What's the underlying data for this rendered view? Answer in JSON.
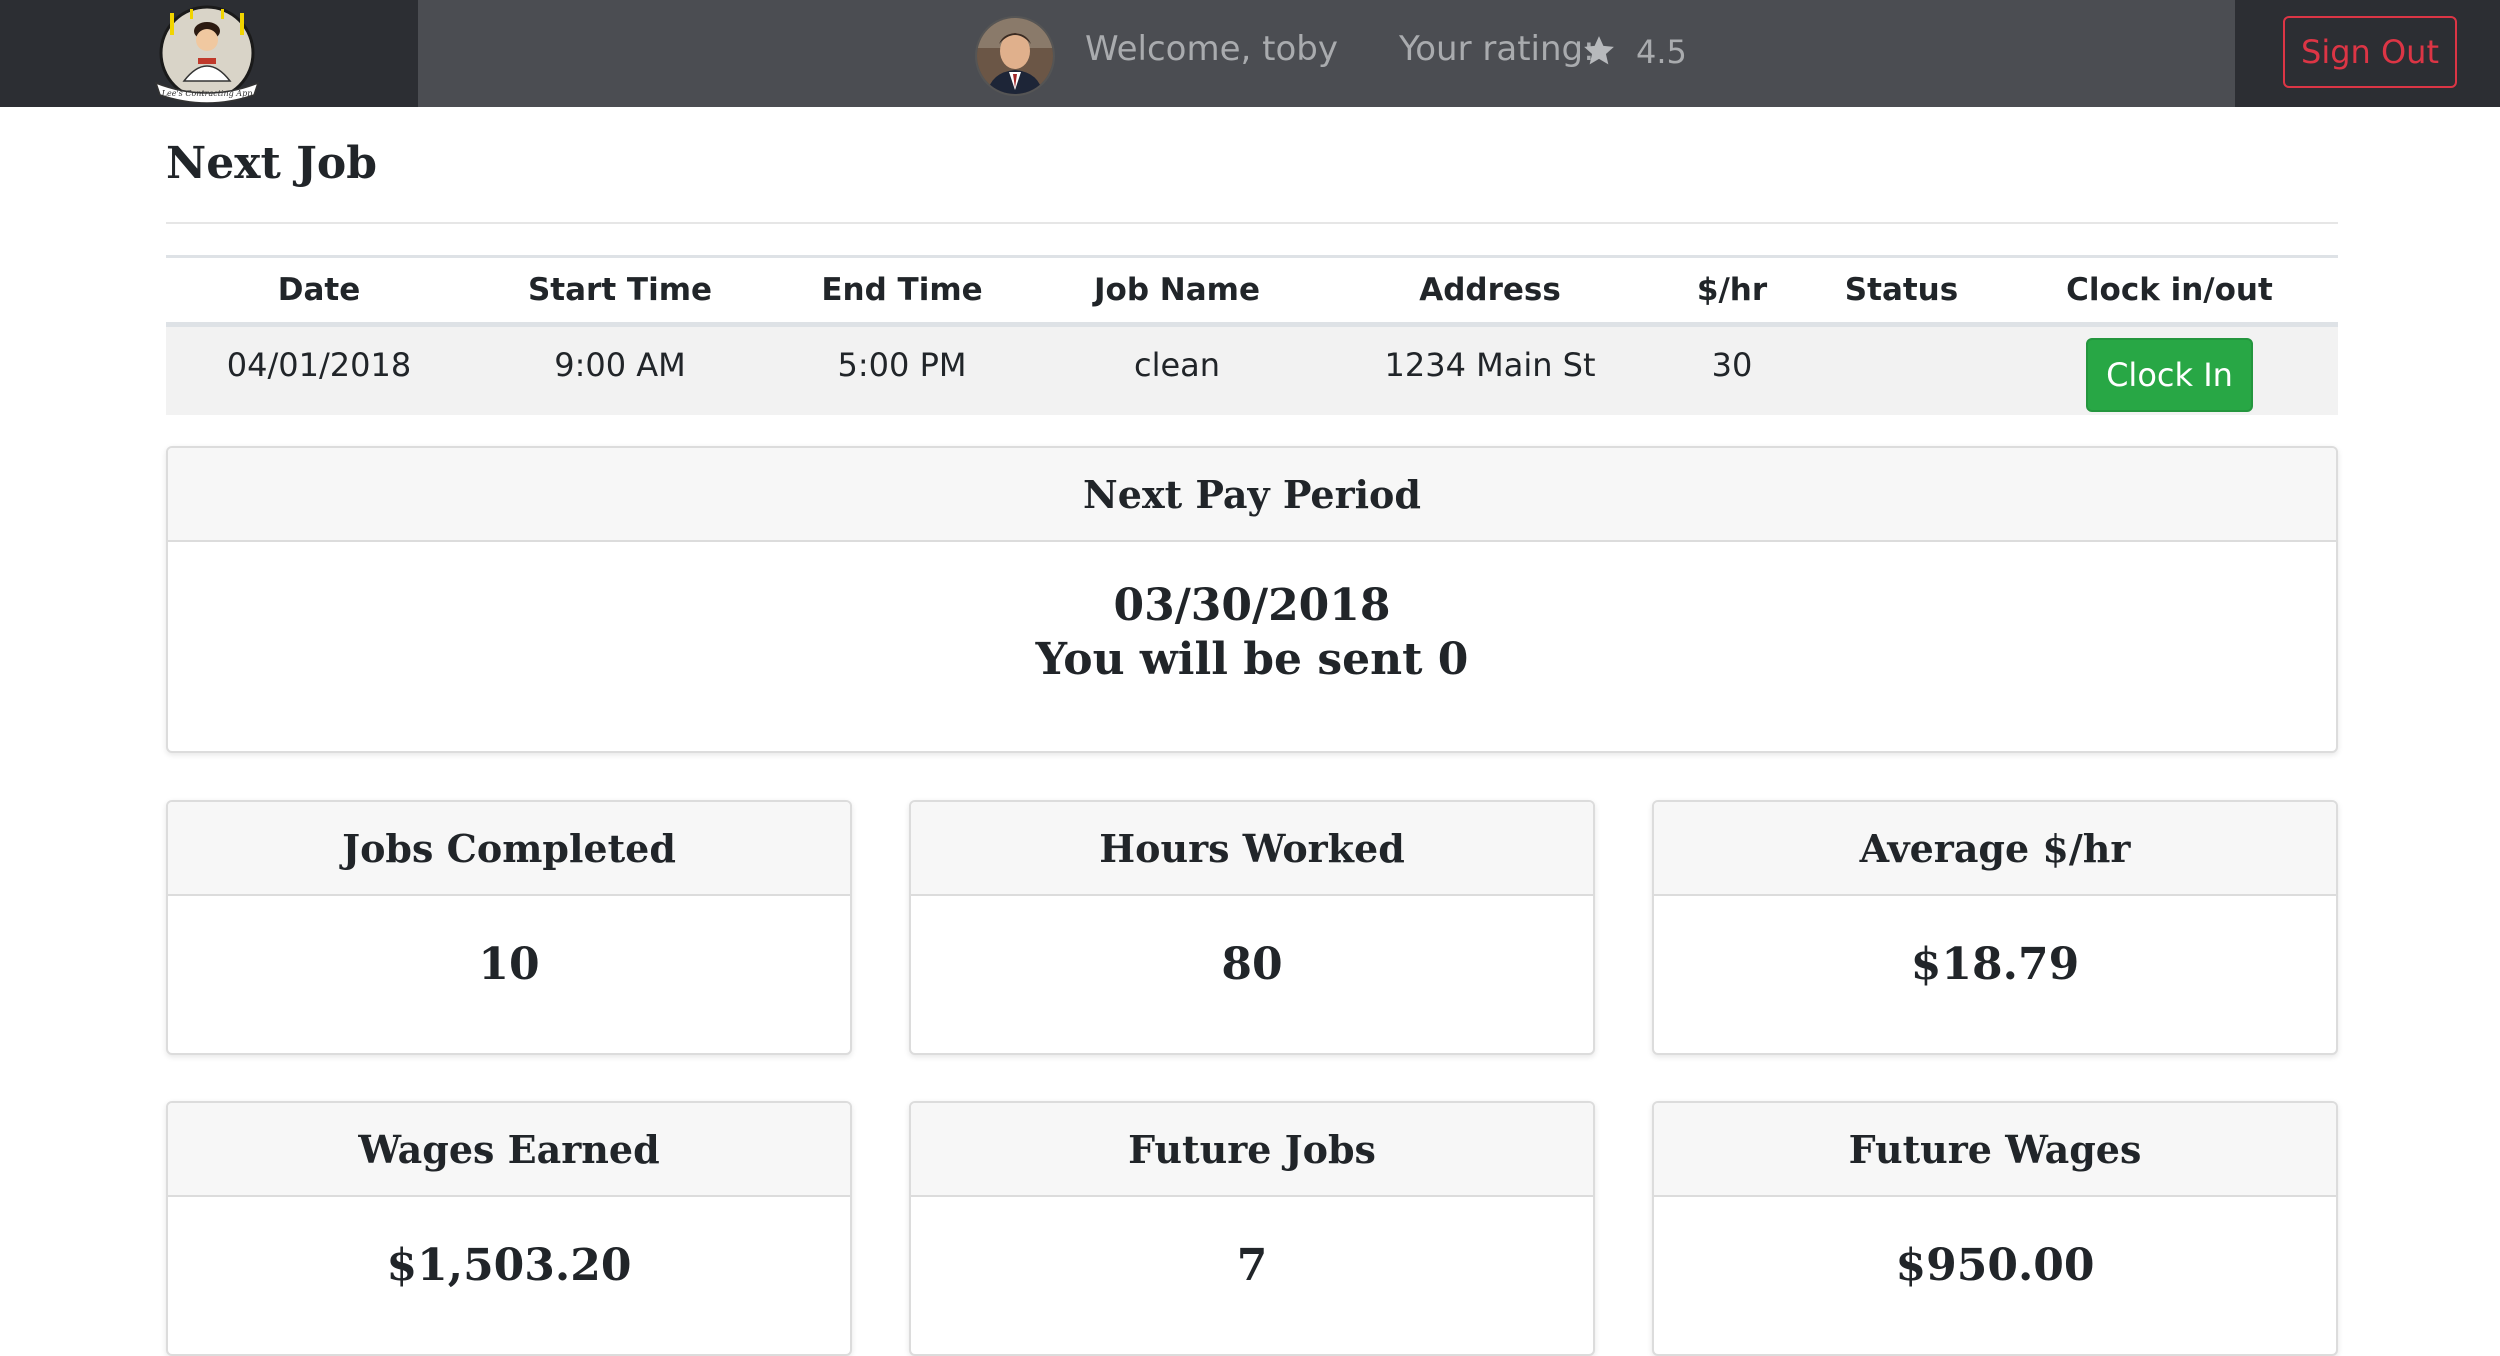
{
  "navbar": {
    "welcome": "Welcome, toby",
    "rating_label": "Your rating:",
    "rating_value": "4.5",
    "sign_out": "Sign Out",
    "logo_text": "Lee's Contracting App"
  },
  "next_job": {
    "title": "Next Job",
    "columns": [
      "Date",
      "Start Time",
      "End Time",
      "Job Name",
      "Address",
      "$/hr",
      "Status",
      "Clock in/out"
    ],
    "row": {
      "date": "04/01/2018",
      "start_time": "9:00 AM",
      "end_time": "5:00 PM",
      "job_name": "clean",
      "address": "1234 Main St",
      "rate": "30",
      "status": "",
      "clock_button": "Clock In"
    }
  },
  "pay_period": {
    "title": "Next Pay Period",
    "date": "03/30/2018",
    "message": "You will be sent 0"
  },
  "stats": [
    {
      "title": "Jobs Completed",
      "value": "10"
    },
    {
      "title": "Hours Worked",
      "value": "80"
    },
    {
      "title": "Average $/hr",
      "value": "$18.79"
    },
    {
      "title": "Wages Earned",
      "value": "$1,503.20"
    },
    {
      "title": "Future Jobs",
      "value": "7"
    },
    {
      "title": "Future Wages",
      "value": "$950.00"
    }
  ],
  "colors": {
    "navbar": "#4b4d52",
    "navbar_dark": "#2c2e33",
    "success": "#28a745",
    "danger": "#dc3545"
  },
  "icons": [
    "app-logo-icon",
    "user-avatar-icon",
    "star-icon"
  ]
}
